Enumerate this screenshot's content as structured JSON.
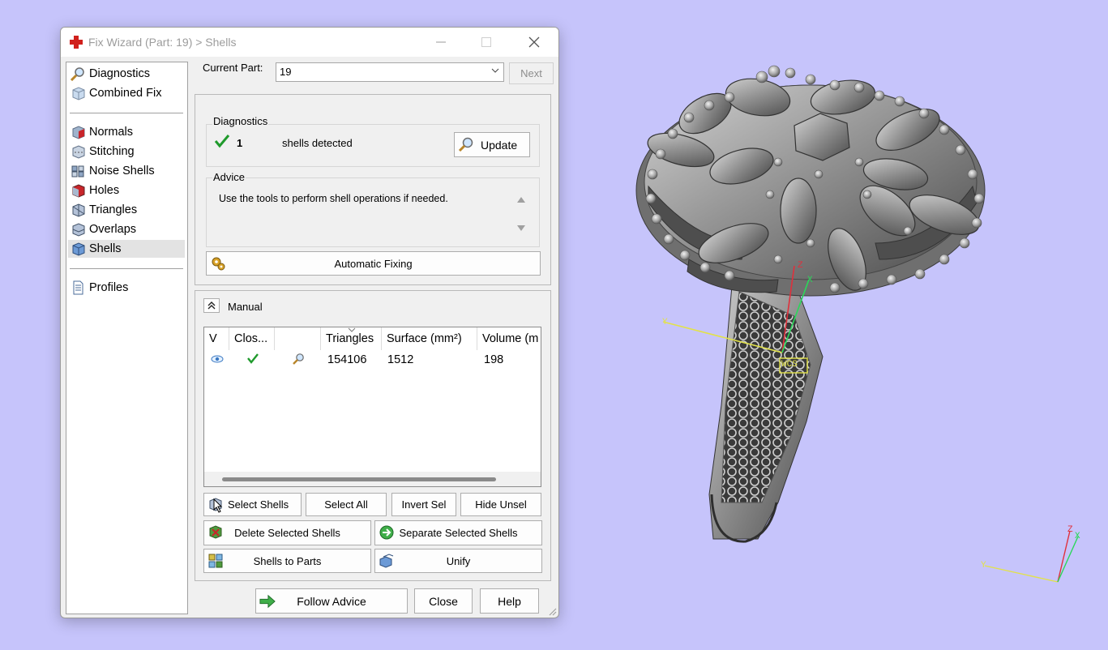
{
  "window": {
    "title": "Fix Wizard (Part: 19) > Shells",
    "controls": {
      "minimize_icon": "minimize-icon",
      "maximize_icon": "maximize-icon",
      "close_icon": "close-icon"
    }
  },
  "sidebar": {
    "groups": [
      [
        {
          "label": "Diagnostics",
          "icon": "magnifier-icon"
        },
        {
          "label": "Combined Fix",
          "icon": "cube-icon"
        }
      ],
      [
        {
          "label": "Normals",
          "icon": "normals-cube-icon"
        },
        {
          "label": "Stitching",
          "icon": "stitching-cube-icon"
        },
        {
          "label": "Noise Shells",
          "icon": "noise-shells-icon"
        },
        {
          "label": "Holes",
          "icon": "holes-cube-icon"
        },
        {
          "label": "Triangles",
          "icon": "triangles-cube-icon"
        },
        {
          "label": "Overlaps",
          "icon": "overlaps-cube-icon"
        },
        {
          "label": "Shells",
          "icon": "shells-cube-icon",
          "selected": true
        }
      ],
      [
        {
          "label": "Profiles",
          "icon": "document-icon"
        }
      ]
    ]
  },
  "current_part": {
    "label": "Current Part:",
    "value": "19",
    "next_label": "Next"
  },
  "diagnostics": {
    "group_label": "Diagnostics",
    "count": "1",
    "text": "shells detected",
    "update_label": "Update"
  },
  "advice": {
    "group_label": "Advice",
    "text": "Use the tools to perform shell operations if needed.",
    "auto_fix_label": "Automatic Fixing"
  },
  "manual": {
    "label": "Manual",
    "columns": [
      "V",
      "Clos...",
      "",
      "Triangles",
      "Surface (mm²)",
      "Volume (m"
    ],
    "rows": [
      {
        "triangles": "154106",
        "surface": "1512",
        "volume": "198"
      }
    ],
    "buttons": {
      "select_shells": "Select Shells",
      "select_all": "Select All",
      "invert_sel": "Invert Sel",
      "hide_unsel": "Hide Unsel",
      "delete_selected": "Delete Selected Shells",
      "separate_selected": "Separate Selected Shells",
      "shells_to_parts": "Shells to Parts",
      "unify": "Unify"
    }
  },
  "footer": {
    "follow_advice": "Follow Advice",
    "close": "Close",
    "help": "Help"
  },
  "viewport": {
    "background": "#c6c4fb",
    "axis_labels": {
      "x": "X",
      "y": "Y",
      "z": "Z",
      "wcs": "WCS"
    }
  },
  "colors": {
    "accent_red": "#d0201c",
    "check_green": "#1f9a2c",
    "axis_x": "#2ad85a",
    "axis_y": "#e2e24a",
    "axis_z": "#e0303c"
  }
}
